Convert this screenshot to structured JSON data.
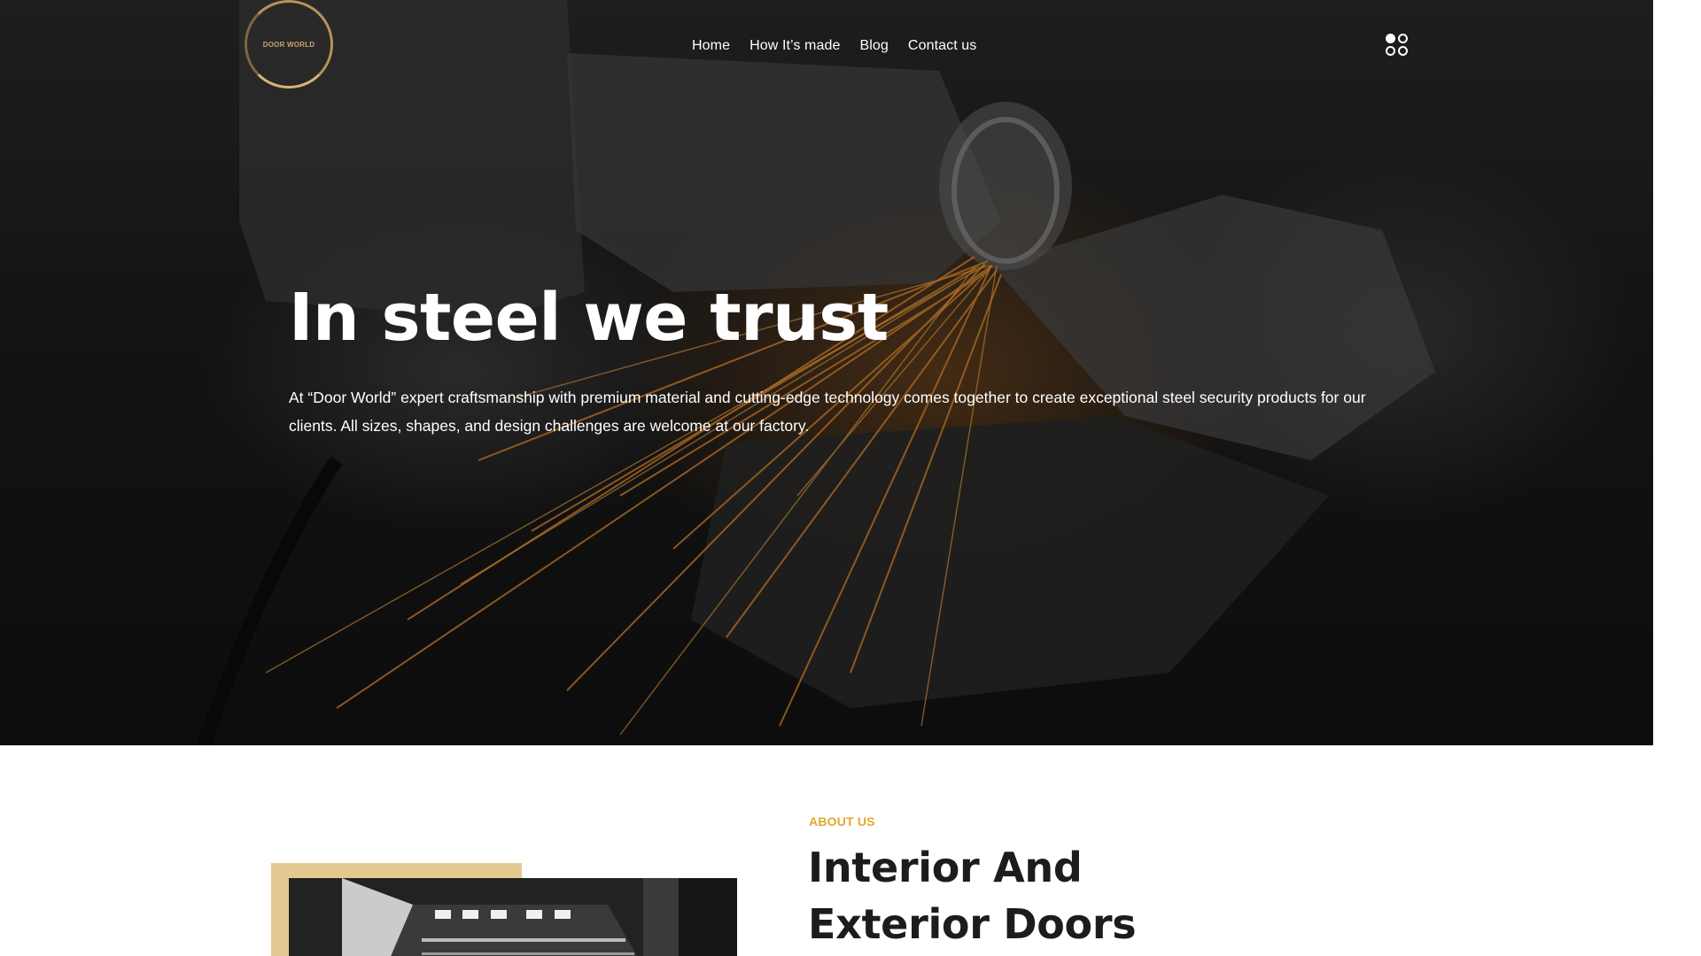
{
  "brand": {
    "logo_text": "DOOR WORLD"
  },
  "nav": {
    "items": [
      {
        "label": "Home"
      },
      {
        "label": "How It’s made"
      },
      {
        "label": "Blog"
      },
      {
        "label": "Contact us"
      }
    ],
    "menu_icon": "apps-grid-icon"
  },
  "hero": {
    "title": "In steel we trust",
    "description": "At “Door World” expert craftsmanship with premium material and cutting-edge technology comes together to create exceptional steel security products for our clients. All sizes, shapes, and design challenges are welcome at our factory."
  },
  "about": {
    "label": "ABOUT US",
    "title_line_1": "Interior And",
    "title_line_2": "Exterior Doors"
  },
  "colors": {
    "accent": "#e3a72f",
    "image_frame": "#e5c992",
    "hero_text": "#ffffff",
    "heading": "#1c1c1c"
  }
}
